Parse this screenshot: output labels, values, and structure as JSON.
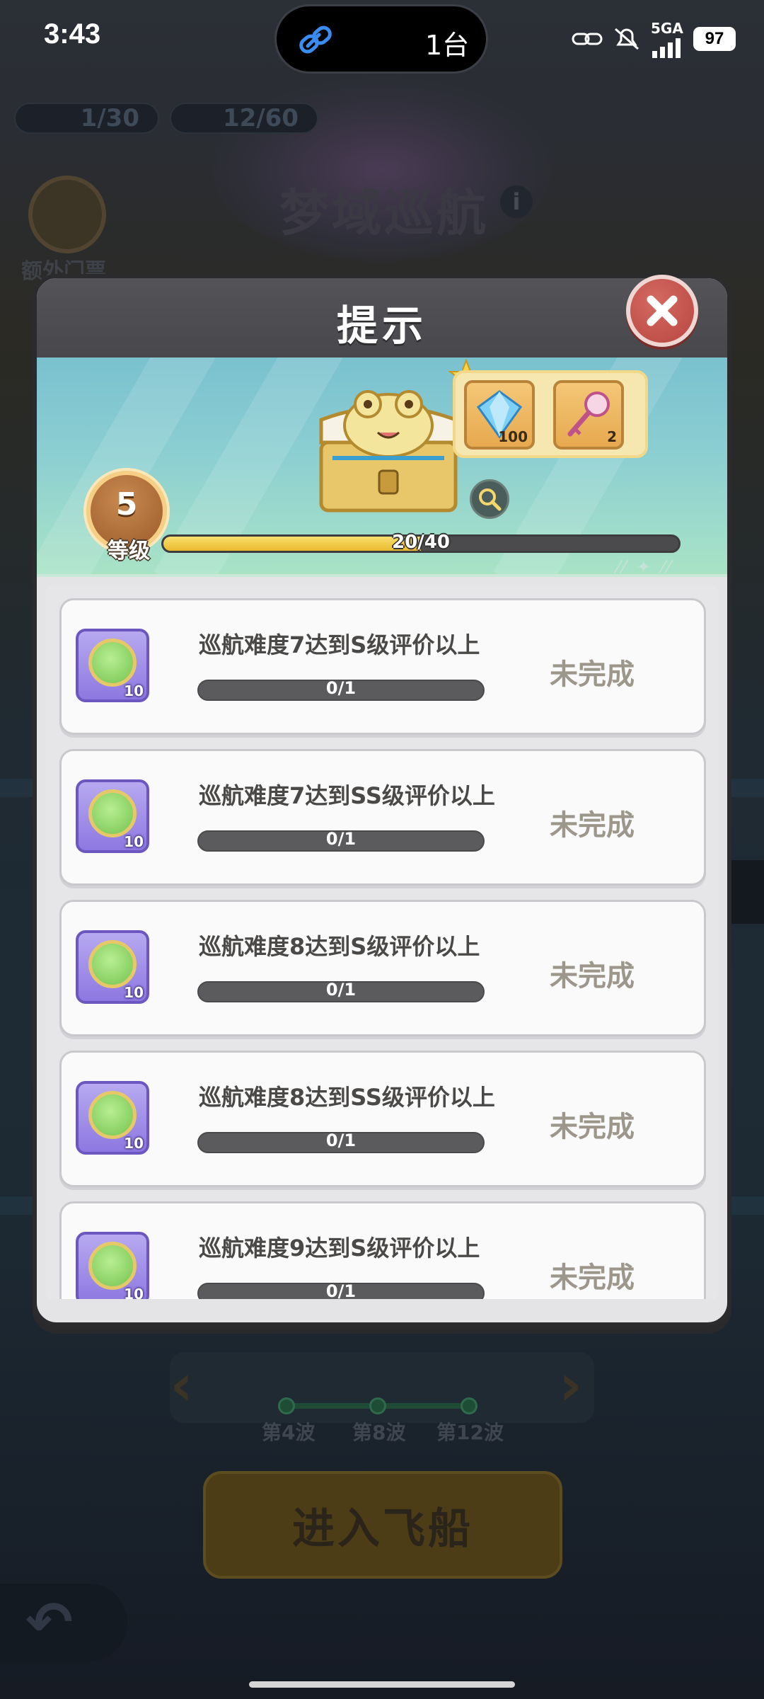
{
  "status_bar": {
    "time": "3:43",
    "island_label": "1台",
    "battery": "97",
    "network": "5GA"
  },
  "background": {
    "ticket_count": "1/30",
    "energy_count": "12/60",
    "mode_title": "梦域巡航",
    "extra_ticket_label": "额外门票",
    "wave_labels": [
      "第4波",
      "第8波",
      "第12波"
    ],
    "enter_button": "进入飞船"
  },
  "modal": {
    "title": "提示",
    "level": {
      "number": "5",
      "label": "等级",
      "progress_text": "20/40",
      "progress_fraction": 0.5
    },
    "rewards": [
      {
        "icon": "diamond-icon",
        "count": "100"
      },
      {
        "icon": "key-icon",
        "count": "2"
      }
    ],
    "tasks": [
      {
        "desc": "巡航难度7达到S级评价以上",
        "reward": "10",
        "progress": "0/1",
        "state": "未完成"
      },
      {
        "desc": "巡航难度7达到SS级评价以上",
        "reward": "10",
        "progress": "0/1",
        "state": "未完成"
      },
      {
        "desc": "巡航难度8达到S级评价以上",
        "reward": "10",
        "progress": "0/1",
        "state": "未完成"
      },
      {
        "desc": "巡航难度8达到SS级评价以上",
        "reward": "10",
        "progress": "0/1",
        "state": "未完成"
      },
      {
        "desc": "巡航难度9达到S级评价以上",
        "reward": "10",
        "progress": "0/1",
        "state": "未完成"
      }
    ]
  }
}
